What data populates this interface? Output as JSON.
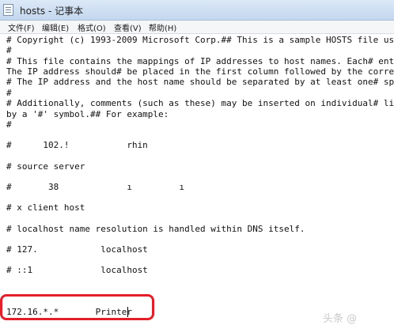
{
  "window": {
    "title": "hosts - 记事本"
  },
  "menu": [
    "文件(F)",
    "编辑(E)",
    "格式(O)",
    "查看(V)",
    "帮助(H)"
  ],
  "lines": [
    "# Copyright (c) 1993-2009 Microsoft Corp.## This is a sample HOSTS file us",
    "#",
    "# This file contains the mappings of IP addresses to host names. Each# ent",
    "The IP address should# be placed in the first column followed by the corre",
    "# The IP address and the host name should be separated by at least one# sp",
    "#",
    "# Additionally, comments (such as these) may be inserted on individual# li",
    "by a '#' symbol.## For example:",
    "#",
    "#      102.!           rhin",
    "# source server",
    "#       38             ı         ı",
    "# x client host",
    "# localhost name resolution is handled within DNS itself.",
    "# 127.            localhost",
    "# ::1             localhost",
    "172.16.*.*       Printer"
  ],
  "watermark": "头条 @"
}
